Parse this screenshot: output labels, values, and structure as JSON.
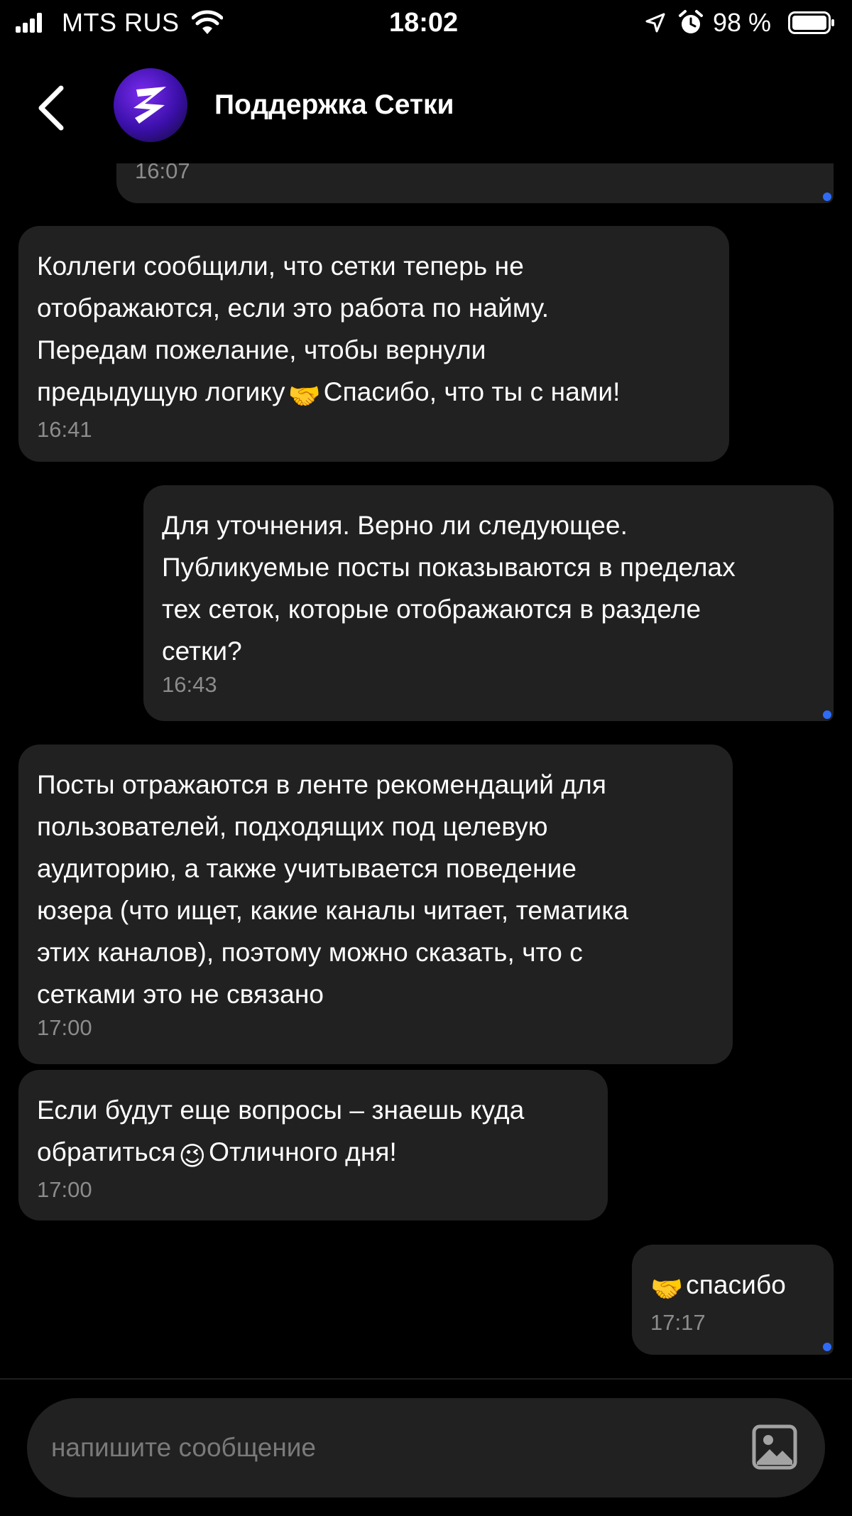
{
  "status_bar": {
    "carrier": "MTS RUS",
    "time": "18:02",
    "battery_percent": "98 %"
  },
  "header": {
    "title": "Поддержка Сетки",
    "avatar_icon": "setka-logo-icon"
  },
  "messages": [
    {
      "direction": "outgoing",
      "text": "",
      "time": "16:07",
      "read": true
    },
    {
      "direction": "incoming",
      "lines": [
        "Коллеги сообщили, что сетки теперь не",
        "отображаются, если это работа по найму.",
        "Передам пожелание, чтобы вернули",
        "предыдущую логику",
        "Спасибо, что ты с нами!"
      ],
      "emoji": "🤝",
      "time": "16:41"
    },
    {
      "direction": "outgoing",
      "text": "Для уточнения. Верно ли следующее.\nПубликуемые посты показываются в пределах\nтех сеток, которые отображаются в разделе\nсетки?",
      "time": "16:43",
      "read": true
    },
    {
      "direction": "incoming",
      "text": "Посты отражаются в ленте рекомендаций для\nпользователей, подходящих под целевую\nаудиторию, а также учитывается поведение\nюзера (что ищет, какие каналы читает, тематика\nэтих каналов), поэтому можно сказать, что с\nсетками это не связано",
      "time": "17:00"
    },
    {
      "direction": "incoming",
      "lines": [
        "Если будут еще вопросы – знаешь куда",
        "обратиться",
        "Отличного дня!"
      ],
      "emoji": "😉",
      "time": "17:00"
    },
    {
      "direction": "outgoing",
      "text": "спасибо",
      "emoji": "🤝",
      "time": "17:17",
      "read": true
    }
  ],
  "composer": {
    "placeholder": "напишите сообщение",
    "attach_icon": "image-icon"
  },
  "colors": {
    "background": "#000000",
    "bubble": "#212121",
    "text": "#ffffff",
    "timestamp": "#8c8c8c",
    "read_indicator": "#2f6cf6",
    "placeholder": "#7a7a7a"
  }
}
